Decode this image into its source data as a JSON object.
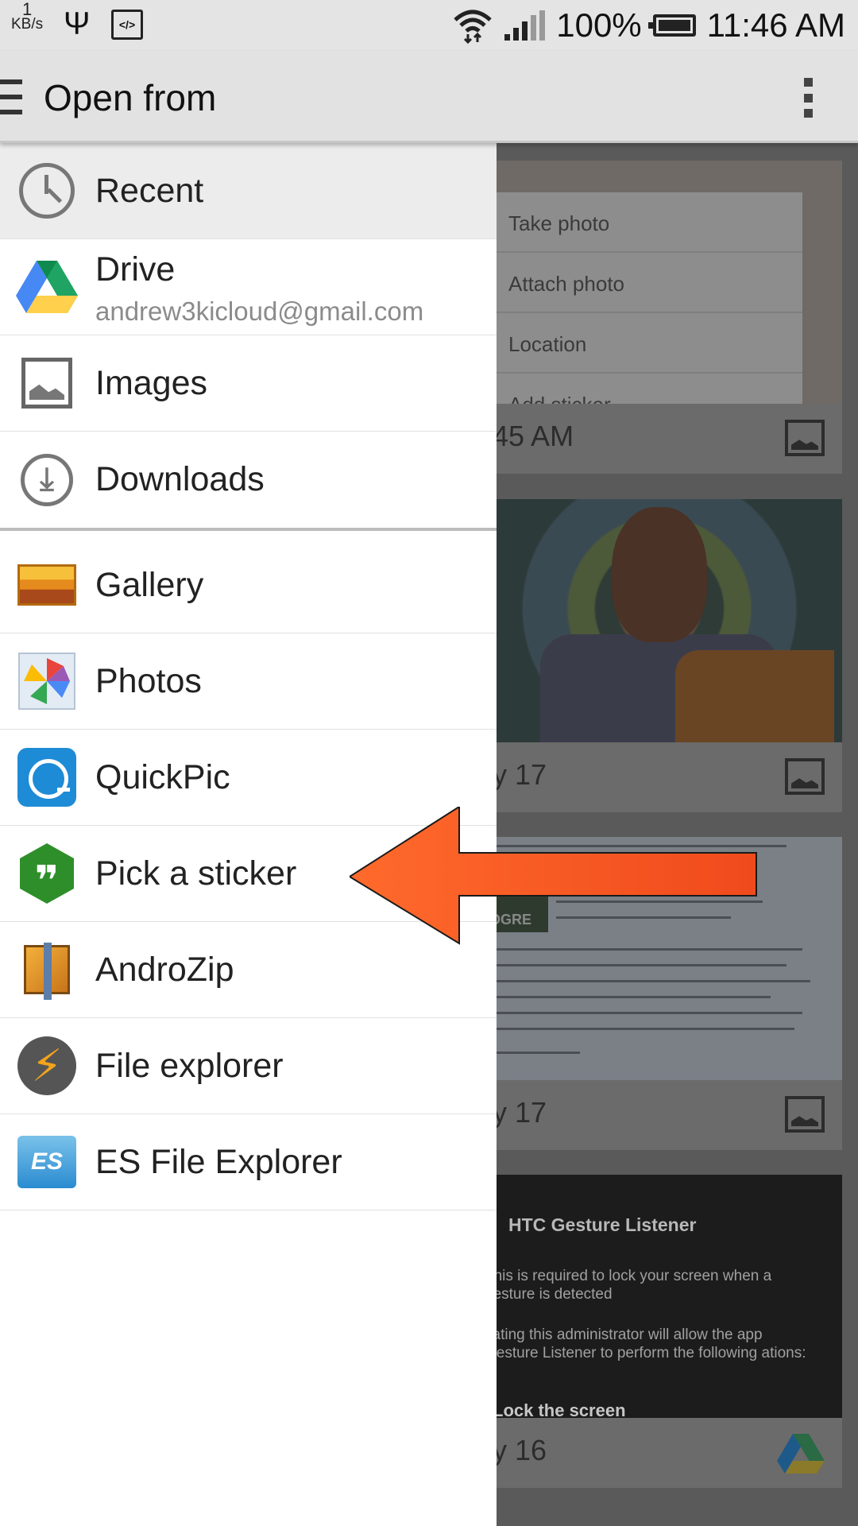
{
  "status_bar": {
    "net_speed": "1",
    "net_unit": "KB/s",
    "battery": "100%",
    "time": "11:46 AM"
  },
  "action_bar": {
    "title": "Open from"
  },
  "drawer": {
    "recent_items": [
      {
        "label": "Recent",
        "icon": "clock-icon"
      },
      {
        "label": "Drive",
        "sublabel": "andrew3kicloud@gmail.com",
        "icon": "google-drive-icon"
      },
      {
        "label": "Images",
        "icon": "image-icon"
      },
      {
        "label": "Downloads",
        "icon": "download-icon"
      }
    ],
    "app_items": [
      {
        "label": "Gallery",
        "icon": "gallery-icon"
      },
      {
        "label": "Photos",
        "icon": "photos-pinwheel-icon"
      },
      {
        "label": "QuickPic",
        "icon": "quickpic-icon"
      },
      {
        "label": "Pick a sticker",
        "icon": "hangouts-icon"
      },
      {
        "label": "AndroZip",
        "icon": "androzip-icon"
      },
      {
        "label": "File explorer",
        "icon": "lightning-icon"
      },
      {
        "label": "ES File Explorer",
        "icon": "es-file-explorer-icon"
      }
    ]
  },
  "background": {
    "menu": [
      "Take photo",
      "Attach photo",
      "Location",
      "Add sticker"
    ],
    "cards": [
      {
        "date": "45 AM"
      },
      {
        "date": "y 17"
      },
      {
        "date": "y 17",
        "logo_text": "OGRE"
      },
      {
        "date": "y 16",
        "heading": "HTC Gesture Listener",
        "line1": "This is required to lock your screen when a gesture is detected",
        "line2": "vating this administrator will allow the app Gesture Listener to perform the following ations:",
        "line3": "Lock the screen"
      }
    ]
  },
  "annotation": {
    "arrow_color": "#ff5a26"
  }
}
